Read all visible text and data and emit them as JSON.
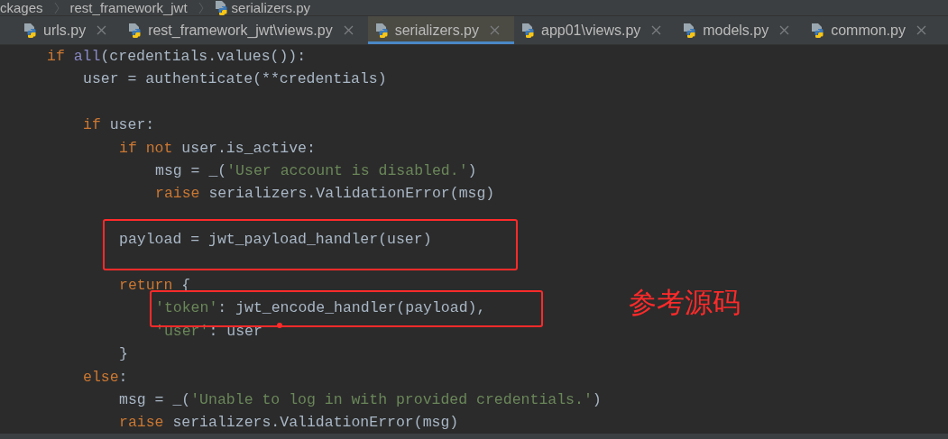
{
  "breadcrumb": [
    {
      "label": "ckages",
      "kind": "folder"
    },
    {
      "label": "rest_framework_jwt",
      "kind": "folder"
    },
    {
      "label": "serializers.py",
      "kind": "python"
    }
  ],
  "tabs": [
    {
      "label": "urls.py",
      "selected": false
    },
    {
      "label": "rest_framework_jwt\\views.py",
      "selected": false
    },
    {
      "label": "serializers.py",
      "selected": true
    },
    {
      "label": "app01\\views.py",
      "selected": false
    },
    {
      "label": "models.py",
      "selected": false
    },
    {
      "label": "common.py",
      "selected": false
    }
  ],
  "code_lines": [
    {
      "tokens": [
        {
          "kind": "keyword",
          "text": "if "
        },
        {
          "kind": "builtin",
          "text": "all"
        },
        {
          "kind": "plain",
          "text": "(credentials.values()):"
        }
      ],
      "children": [
        {
          "tokens": [
            {
              "kind": "plain",
              "text": "user = authenticate(**credentials)"
            }
          ]
        },
        {
          "gap_before": true,
          "tokens": [
            {
              "kind": "keyword",
              "text": "if"
            },
            {
              "kind": "plain",
              "text": " user:"
            }
          ],
          "children": [
            {
              "tokens": [
                {
                  "kind": "keyword",
                  "text": "if not"
                },
                {
                  "kind": "plain",
                  "text": " user.is_active:"
                }
              ],
              "children": [
                {
                  "tokens": [
                    {
                      "kind": "plain",
                      "text": "msg = _("
                    },
                    {
                      "kind": "string",
                      "text": "'User account is disabled.'"
                    },
                    {
                      "kind": "plain",
                      "text": ")"
                    }
                  ]
                },
                {
                  "tokens": [
                    {
                      "kind": "keyword",
                      "text": "raise"
                    },
                    {
                      "kind": "plain",
                      "text": " serializers.ValidationError(msg)"
                    }
                  ]
                }
              ]
            },
            {
              "gap_before": true,
              "tokens": [
                {
                  "kind": "plain",
                  "text": "payload = jwt_payload_handler(user)"
                }
              ]
            },
            {
              "gap_before": true,
              "tokens": [
                {
                  "kind": "keyword",
                  "text": "return"
                },
                {
                  "kind": "plain",
                  "text": " {"
                }
              ],
              "children": [
                {
                  "tokens": [
                    {
                      "kind": "string",
                      "text": "'token'"
                    },
                    {
                      "kind": "plain",
                      "text": ": jwt_encode_handler(payload),"
                    }
                  ]
                },
                {
                  "tokens": [
                    {
                      "kind": "string",
                      "text": "'user'"
                    },
                    {
                      "kind": "plain",
                      "text": ": user"
                    }
                  ]
                }
              ]
            },
            {
              "tokens": [
                {
                  "kind": "plain",
                  "text": "}"
                }
              ]
            }
          ]
        },
        {
          "tokens": [
            {
              "kind": "keyword",
              "text": "else"
            },
            {
              "kind": "plain",
              "text": ":"
            }
          ],
          "children": [
            {
              "tokens": [
                {
                  "kind": "plain",
                  "text": "msg = _("
                },
                {
                  "kind": "string",
                  "text": "'Unable to log in with provided credentials.'"
                },
                {
                  "kind": "plain",
                  "text": ")"
                }
              ]
            },
            {
              "tokens": [
                {
                  "kind": "keyword",
                  "text": "raise"
                },
                {
                  "kind": "plain",
                  "text": " serializers.ValidationError(msg)"
                }
              ]
            }
          ]
        }
      ]
    }
  ],
  "annotation": {
    "note": "参考源码"
  }
}
